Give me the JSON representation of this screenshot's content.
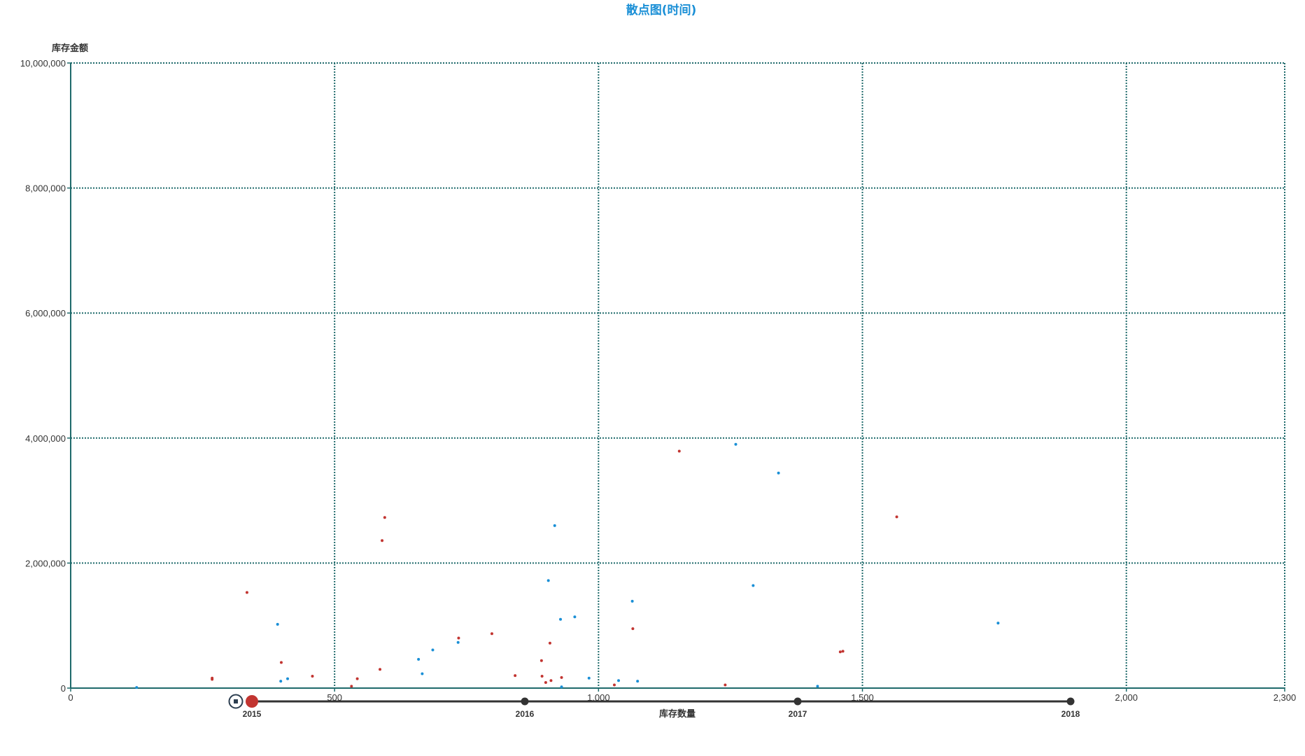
{
  "chart_data": {
    "type": "scatter",
    "title": "散点图(时间)",
    "xlabel": "库存数量",
    "ylabel": "库存金额",
    "xlim": [
      0,
      2300
    ],
    "ylim": [
      0,
      10000000
    ],
    "x_ticks": [
      {
        "value": 0,
        "label": "0"
      },
      {
        "value": 500,
        "label": "500"
      },
      {
        "value": 1000,
        "label": "1,000"
      },
      {
        "value": 1500,
        "label": "1,500"
      },
      {
        "value": 2000,
        "label": "2,000"
      },
      {
        "value": 2300,
        "label": "2,300"
      }
    ],
    "y_ticks": [
      {
        "value": 0,
        "label": "0"
      },
      {
        "value": 2000000,
        "label": "2,000,000"
      },
      {
        "value": 4000000,
        "label": "4,000,000"
      },
      {
        "value": 6000000,
        "label": "6,000,000"
      },
      {
        "value": 8000000,
        "label": "8,000,000"
      },
      {
        "value": 10000000,
        "label": "10,000,000"
      }
    ],
    "grid": true,
    "series": [
      {
        "color": "#c23531",
        "points": [
          {
            "x": 268,
            "y": 160000
          },
          {
            "x": 268,
            "y": 140000
          },
          {
            "x": 334,
            "y": 1530000
          },
          {
            "x": 399,
            "y": 410000
          },
          {
            "x": 458,
            "y": 190000
          },
          {
            "x": 532,
            "y": 30000
          },
          {
            "x": 543,
            "y": 150000
          },
          {
            "x": 586,
            "y": 300000
          },
          {
            "x": 590,
            "y": 2360000
          },
          {
            "x": 595,
            "y": 2730000
          },
          {
            "x": 735,
            "y": 800000
          },
          {
            "x": 798,
            "y": 870000
          },
          {
            "x": 842,
            "y": 200000
          },
          {
            "x": 892,
            "y": 440000
          },
          {
            "x": 893,
            "y": 190000
          },
          {
            "x": 900,
            "y": 90000
          },
          {
            "x": 908,
            "y": 720000
          },
          {
            "x": 910,
            "y": 120000
          },
          {
            "x": 930,
            "y": 170000
          },
          {
            "x": 1030,
            "y": 50000
          },
          {
            "x": 1065,
            "y": 950000
          },
          {
            "x": 1153,
            "y": 3790000
          },
          {
            "x": 1240,
            "y": 50000
          },
          {
            "x": 1458,
            "y": 580000
          },
          {
            "x": 1463,
            "y": 590000
          },
          {
            "x": 1565,
            "y": 2740000
          }
        ]
      },
      {
        "color": "#1a8fd6",
        "points": [
          {
            "x": 125,
            "y": 10000
          },
          {
            "x": 392,
            "y": 1020000
          },
          {
            "x": 398,
            "y": 110000
          },
          {
            "x": 411,
            "y": 150000
          },
          {
            "x": 659,
            "y": 460000
          },
          {
            "x": 666,
            "y": 230000
          },
          {
            "x": 686,
            "y": 610000
          },
          {
            "x": 734,
            "y": 730000
          },
          {
            "x": 905,
            "y": 1720000
          },
          {
            "x": 917,
            "y": 2600000
          },
          {
            "x": 928,
            "y": 1100000
          },
          {
            "x": 930,
            "y": 20000
          },
          {
            "x": 955,
            "y": 1140000
          },
          {
            "x": 982,
            "y": 160000
          },
          {
            "x": 1038,
            "y": 120000
          },
          {
            "x": 1064,
            "y": 1390000
          },
          {
            "x": 1074,
            "y": 110000
          },
          {
            "x": 1260,
            "y": 3900000
          },
          {
            "x": 1293,
            "y": 1640000
          },
          {
            "x": 1341,
            "y": 3440000
          },
          {
            "x": 1415,
            "y": 30000
          },
          {
            "x": 1757,
            "y": 1040000
          }
        ]
      }
    ],
    "timeline": {
      "labels": [
        "2015",
        "2016",
        "2017",
        "2018"
      ],
      "current_index": 0
    },
    "colors": {
      "title": "#1a8fd6",
      "axis_line": "#1f6a6b",
      "grid": "#1f6a6b",
      "timeline_line": "#333333",
      "timeline_current": "#c23531",
      "timeline_dot": "#333333"
    },
    "icons": {
      "play_control": "stop-icon"
    }
  }
}
